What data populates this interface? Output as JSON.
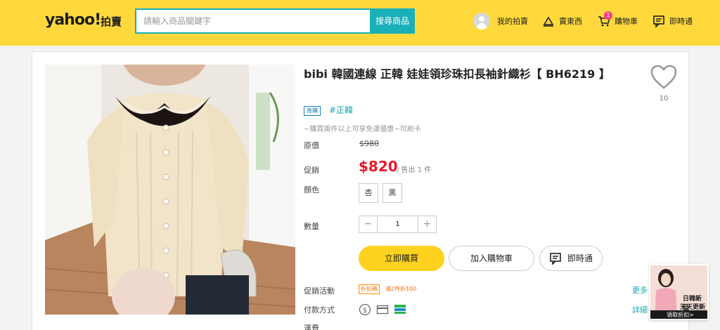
{
  "header": {
    "logo": "yahoo!",
    "logo_sub": "拍賣",
    "search_placeholder": "請輸入商品關鍵字",
    "search_button": "搜尋商品",
    "nav": {
      "my_auction": "我的拍賣",
      "sell": "賣東西",
      "cart": "購物車",
      "cart_count": "1",
      "chat": "即時通"
    }
  },
  "product": {
    "title": "bibi 韓國連線 正韓 娃娃領珍珠扣長袖針織衫【 BH6219 】",
    "favorite_count": "10",
    "brand_tag": "直購",
    "hash_tag": "#正韓",
    "promo_text": "~購買兩件以上可享免運優惠~可刷卡",
    "labels": {
      "original_price": "原價",
      "sale": "促銷",
      "color": "顏色",
      "quantity": "數量",
      "activity": "促銷活動",
      "payment": "付款方式",
      "shipping": "運費"
    },
    "original_price": "$980",
    "sale_price": "$820",
    "sold_text": "/ 售出 1 件",
    "colors": [
      "杏",
      "黑"
    ],
    "quantity": "1",
    "buy_button": "立即購買",
    "cart_button": "加入購物車",
    "chat_button": "即時通",
    "activity_tag": "折扣碼",
    "activity_text": "滿2件折100",
    "more_link": "更多",
    "detail_link": "詳細"
  },
  "ad": {
    "line1": "日韓新品",
    "line2": "天天更新",
    "line3": "領取折扣>"
  },
  "colors": {
    "header_bg": "#ffd93c",
    "accent_teal": "#19b0b8",
    "price_red": "#e8192c",
    "buy_yellow": "#ffd21f"
  }
}
